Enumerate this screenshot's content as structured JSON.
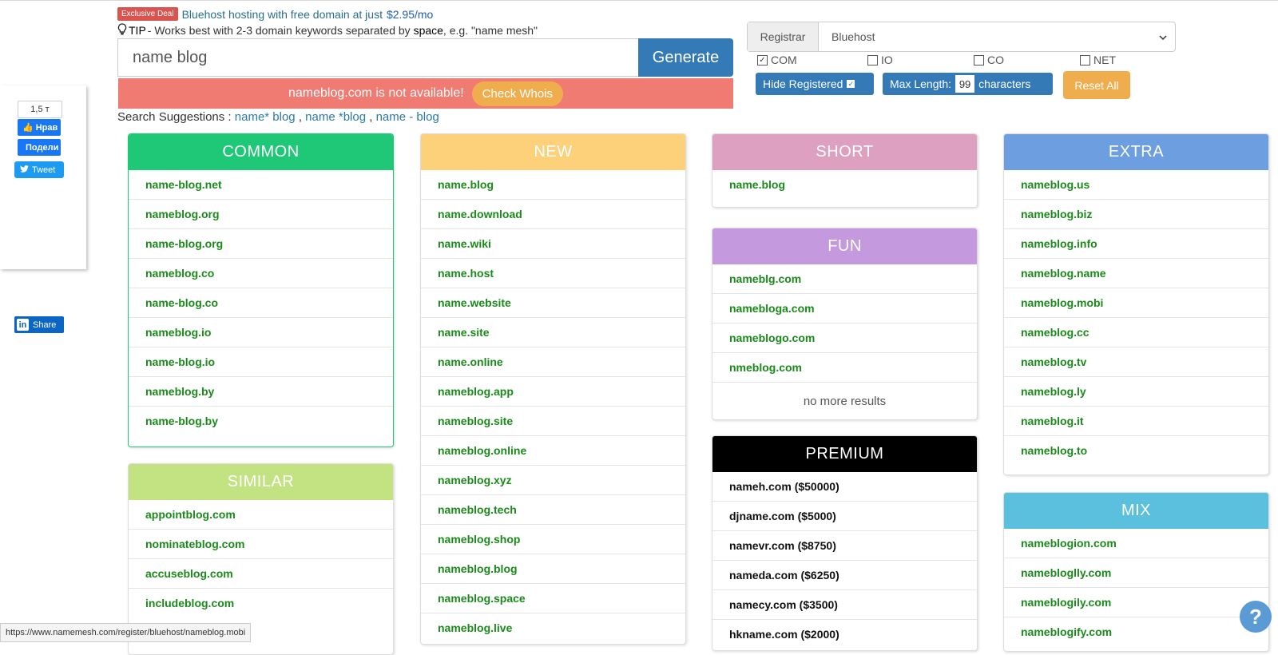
{
  "promo": {
    "badge": "Exclusive Deal",
    "text": "Bluehost hosting with free domain at just",
    "price": "$2.95/mo"
  },
  "tip": {
    "icon": "lightbulb-icon",
    "label": "TIP",
    "text_before": " - Works best with 2-3 domain keywords separated by ",
    "bold_word": "space",
    "text_after": ", e.g. \"name mesh\""
  },
  "search": {
    "value": "name blog",
    "generate_label": "Generate"
  },
  "availability": {
    "domain": "nameblog.com",
    "message": "is not available!",
    "whois_label": "Check Whois"
  },
  "suggestions": {
    "label": "Search Suggestions : ",
    "items": [
      "name* blog",
      "name *blog",
      "name - blog"
    ],
    "separator": " , "
  },
  "registrar": {
    "label": "Registrar",
    "selected": "Bluehost"
  },
  "tlds": [
    {
      "label": "COM",
      "checked": true
    },
    {
      "label": "IO",
      "checked": false
    },
    {
      "label": "CO",
      "checked": false
    },
    {
      "label": "NET",
      "checked": false
    }
  ],
  "options": {
    "hide_registered": "Hide Registered",
    "max_length_label": "Max Length:",
    "max_length_value": "99",
    "characters": "characters",
    "reset": "Reset All"
  },
  "social": {
    "fb_count": "1,5 т",
    "fb_like": "Нрав",
    "fb_share": "Подели",
    "tweet": "Tweet",
    "linkedin": "Share"
  },
  "panels": {
    "common": {
      "title": "COMMON",
      "color": "#1ec876",
      "items": [
        "name-blog.net",
        "nameblog.org",
        "name-blog.org",
        "nameblog.co",
        "name-blog.co",
        "nameblog.io",
        "name-blog.io",
        "nameblog.by",
        "name-blog.by"
      ]
    },
    "similar": {
      "title": "SIMILAR",
      "color": "#c3e281",
      "items": [
        "appointblog.com",
        "nominateblog.com",
        "accuseblog.com",
        "includeblog.com"
      ]
    },
    "new": {
      "title": "NEW",
      "color": "#fdd17a",
      "items": [
        "name.blog",
        "name.download",
        "name.wiki",
        "name.host",
        "name.website",
        "name.site",
        "name.online",
        "nameblog.app",
        "nameblog.site",
        "nameblog.online",
        "nameblog.xyz",
        "nameblog.tech",
        "nameblog.shop",
        "nameblog.blog",
        "nameblog.space",
        "nameblog.live"
      ]
    },
    "short": {
      "title": "SHORT",
      "color": "#dda0c0",
      "items": [
        "name.blog"
      ]
    },
    "fun": {
      "title": "FUN",
      "color": "#c599dd",
      "items": [
        "nameblg.com",
        "namebloga.com",
        "nameblogo.com",
        "nmeblog.com"
      ],
      "no_more": "no more results"
    },
    "premium": {
      "title": "PREMIUM",
      "color": "#000000",
      "items": [
        "nameh.com ($50000)",
        "djname.com ($5000)",
        "namevr.com ($8750)",
        "nameda.com ($6250)",
        "namecy.com ($3500)",
        "hkname.com ($2000)"
      ]
    },
    "extra": {
      "title": "EXTRA",
      "color": "#6c9ee0",
      "items": [
        "nameblog.us",
        "nameblog.biz",
        "nameblog.info",
        "nameblog.name",
        "nameblog.mobi",
        "nameblog.cc",
        "nameblog.tv",
        "nameblog.ly",
        "nameblog.it",
        "nameblog.to"
      ]
    },
    "mix": {
      "title": "MIX",
      "color": "#5bc0de",
      "items": [
        "nameblogion.com",
        "namebloglly.com",
        "nameblogily.com",
        "nameblogify.com"
      ]
    }
  },
  "status_url": "https://www.namemesh.com/register/bluehost/nameblog.mobi",
  "help_icon": "question-icon"
}
